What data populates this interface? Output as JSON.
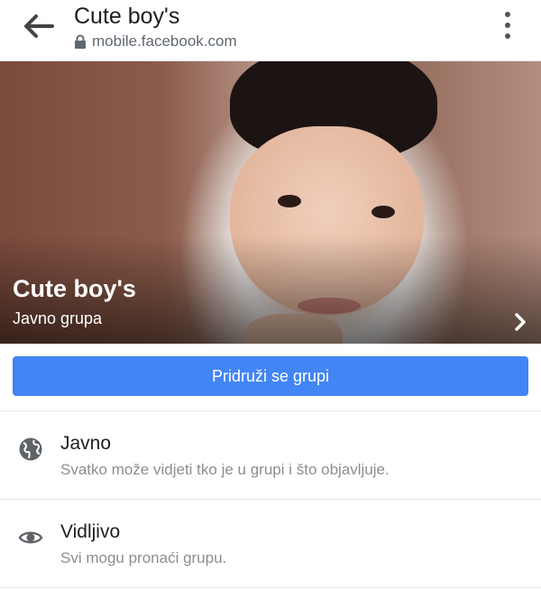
{
  "header": {
    "title": "Cute boy's",
    "url": "mobile.facebook.com",
    "back_icon": "back-arrow-icon",
    "menu_icon": "more-vertical-icon",
    "lock_icon": "lock-icon"
  },
  "cover": {
    "group_name": "Cute boy's",
    "group_type": "Javno grupa",
    "chevron_icon": "chevron-right-icon"
  },
  "join_button": {
    "label": "Pridruži se grupi",
    "color": "#4285f4"
  },
  "info": [
    {
      "icon": "globe-icon",
      "title": "Javno",
      "subtitle": "Svatko može vidjeti tko je u grupi i što objavljuje."
    },
    {
      "icon": "eye-icon",
      "title": "Vidljivo",
      "subtitle": "Svi mogu pronaći grupu."
    }
  ]
}
